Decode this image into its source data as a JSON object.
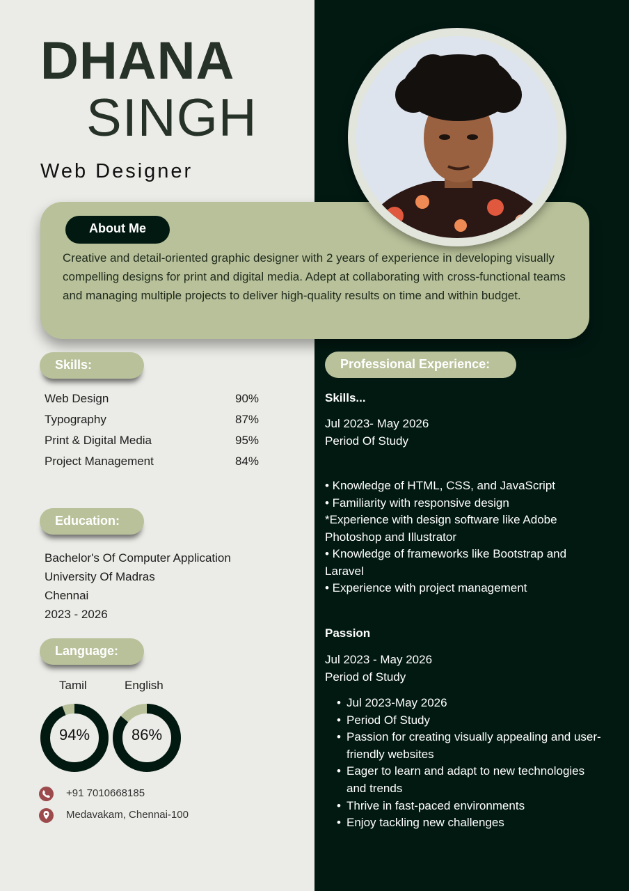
{
  "header": {
    "first_name": "DHANA",
    "last_name": "SINGH",
    "title": "Web Designer"
  },
  "about": {
    "heading": "About Me",
    "text": "Creative and detail-oriented graphic designer with 2 years of experience in developing visually compelling designs for print and digital media. Adept at collaborating with cross-functional teams and managing multiple projects to deliver high-quality results on time and within budget."
  },
  "skills": {
    "heading": "Skills:",
    "items": [
      {
        "name": "Web Design",
        "percent": "90%"
      },
      {
        "name": "Typography",
        "percent": "87%"
      },
      {
        "name": "Print & Digital Media",
        "percent": "95%"
      },
      {
        "name": "Project Management",
        "percent": "84%"
      }
    ]
  },
  "education": {
    "heading": "Education:",
    "lines": [
      "Bachelor's Of Computer Application",
      "University Of Madras",
      "Chennai",
      "2023 - 2026"
    ]
  },
  "language": {
    "heading": "Language:",
    "items": [
      {
        "name": "Tamil",
        "label": "94%",
        "value": 0.94
      },
      {
        "name": "English",
        "label": "86%",
        "value": 0.86
      }
    ]
  },
  "contact": {
    "phone": "+91 7010668185",
    "address": "Medavakam, Chennai-100",
    "phone_icon": "phone-icon",
    "location_icon": "location-pin-icon"
  },
  "experience": {
    "heading": "Professional Experience:",
    "skills_title": "Skills...",
    "skills_period": [
      "Jul 2023- May 2026",
      "Period Of Study"
    ],
    "skills_lines": [
      "• Knowledge of HTML, CSS, and JavaScript",
      "• Familiarity with responsive design",
      "*Experience with design software like Adobe",
      "Photoshop and Illustrator",
      "• Knowledge of frameworks like Bootstrap and",
      "Laravel",
      "• Experience with project management"
    ],
    "passion_title": "Passion",
    "passion_period": [
      "Jul 2023 - May 2026",
      "Period of Study"
    ],
    "passion_list": [
      "Jul 2023-May 2026",
      "Period Of Study",
      " Passion for creating visually appealing and user-friendly websites",
      "Eager to learn and adapt to new technologies and trends",
      "Thrive in fast-paced environments",
      "Enjoy tackling new challenges"
    ]
  },
  "colors": {
    "dark_green": "#021912",
    "sage": "#b8c19a",
    "background": "#ebebe7",
    "icon_red": "#9c4a4c"
  }
}
